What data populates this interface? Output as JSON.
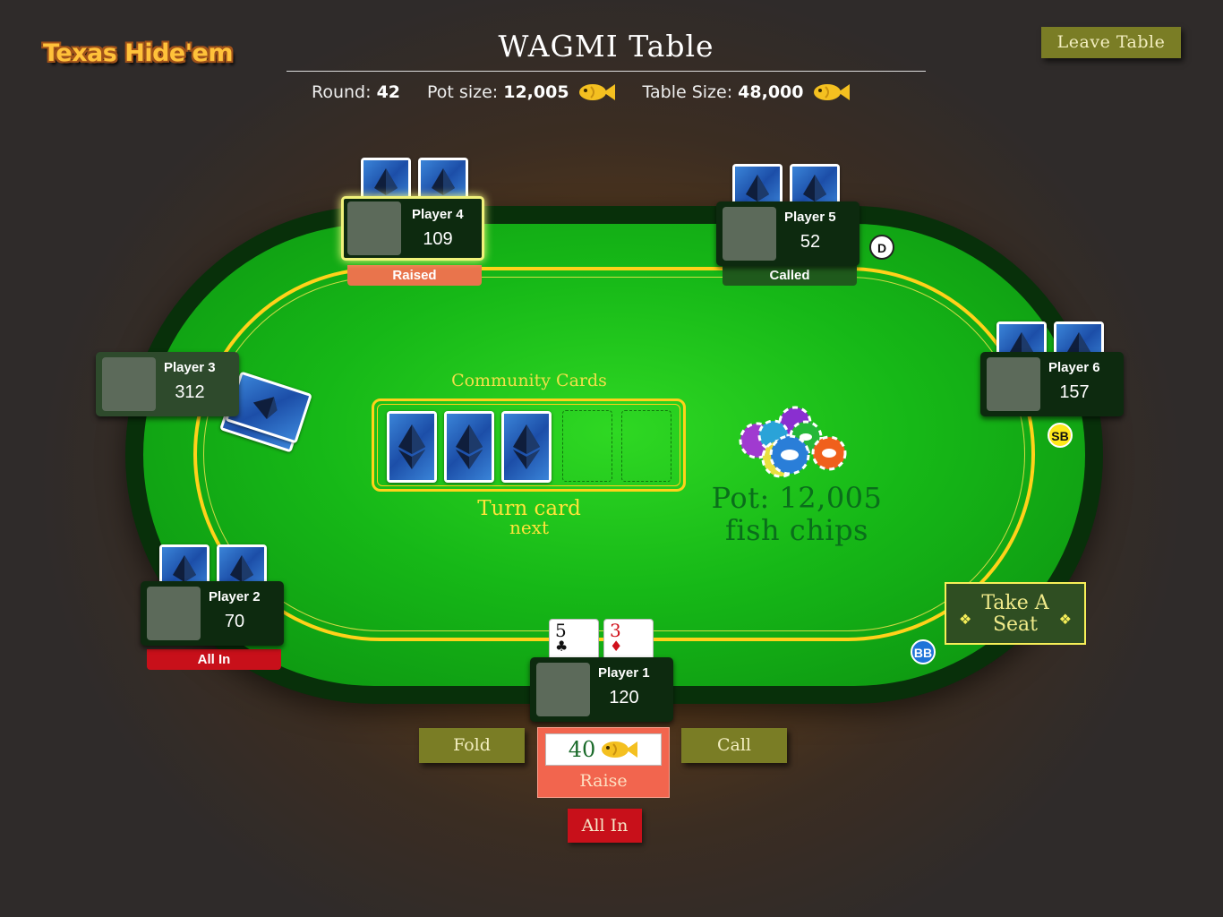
{
  "header": {
    "logo": "Texas Hide'em",
    "title": "WAGMI Table",
    "round_label": "Round:",
    "round_value": "42",
    "pot_label": "Pot size:",
    "pot_value": "12,005",
    "table_label": "Table Size:",
    "table_value": "48,000",
    "leave_button": "Leave Table"
  },
  "table": {
    "community_label": "Community Cards",
    "turn_label": "Turn card",
    "turn_sub": "next",
    "pot_line1": "Pot: 12,005",
    "pot_line2": "fish chips",
    "take_seat_line1": "Take A",
    "take_seat_line2": "Seat",
    "community_cards_dealt": 3,
    "community_slots": 5
  },
  "players": {
    "p1": {
      "name": "Player 1",
      "chips": "120",
      "card1_rank": "5",
      "card1_suit": "♣",
      "card2_rank": "3",
      "card2_suit": "♦"
    },
    "p2": {
      "name": "Player 2",
      "chips": "70",
      "status": "All In"
    },
    "p3": {
      "name": "Player 3",
      "chips": "312"
    },
    "p4": {
      "name": "Player 4",
      "chips": "109",
      "status": "Raised"
    },
    "p5": {
      "name": "Player 5",
      "chips": "52",
      "status": "Called"
    },
    "p6": {
      "name": "Player 6",
      "chips": "157"
    }
  },
  "markers": {
    "dealer": "D",
    "small_blind": "SB",
    "big_blind": "BB"
  },
  "actions": {
    "fold": "Fold",
    "call": "Call",
    "raise_amount": "40",
    "raise": "Raise",
    "all_in": "All In"
  },
  "colors": {
    "felt": "#16b817",
    "rail": "#08300a",
    "gold_line": "#ffd21a",
    "button": "#7a7d25",
    "raise": "#f2654e",
    "all_in": "#c8101a",
    "raised_status": "#e9744c",
    "called_status": "#1f5a1c",
    "all_in_status": "#c8101a"
  },
  "icons": {
    "currency": "fish-icon",
    "card_back": "ethereum-diamond-card-back",
    "chips": "poker-chip-stack-icon"
  }
}
